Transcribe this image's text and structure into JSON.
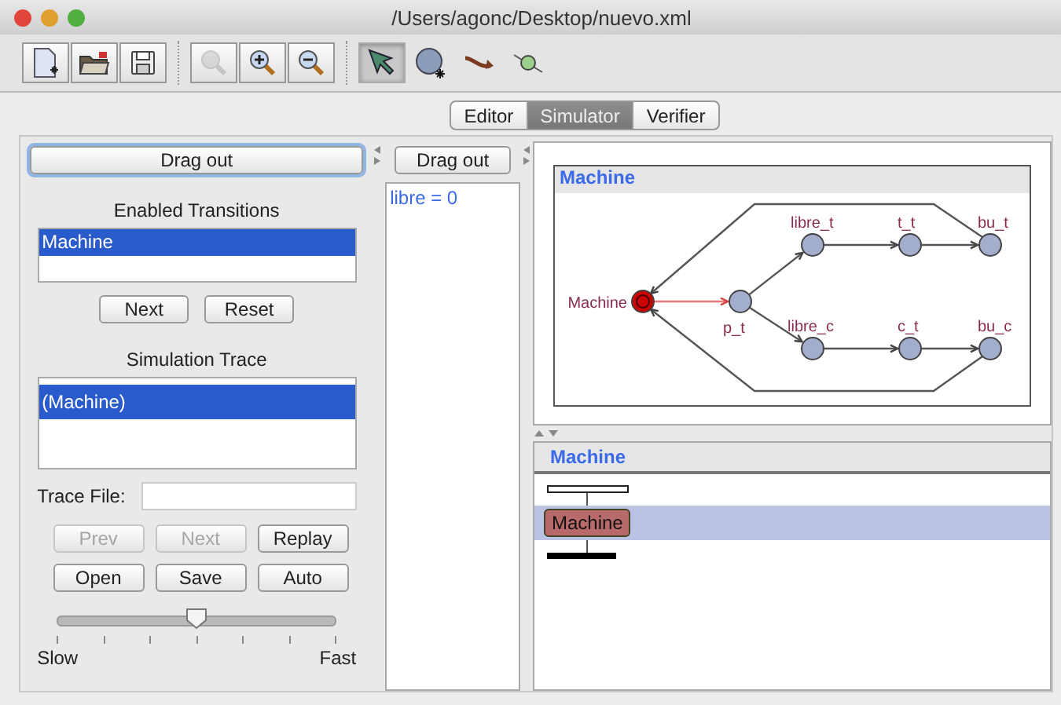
{
  "window": {
    "title": "/Users/agonc/Desktop/nuevo.xml"
  },
  "toolbar": [
    {
      "selected": false,
      "disabled": false
    },
    {
      "selected": false,
      "disabled": false
    },
    {
      "selected": false,
      "disabled": false
    },
    {
      "selected": false,
      "disabled": true
    },
    {
      "selected": false,
      "disabled": false
    },
    {
      "selected": false,
      "disabled": false
    },
    {
      "selected": true,
      "disabled": false
    },
    {
      "selected": false,
      "disabled": false
    },
    {
      "selected": false,
      "disabled": false
    },
    {
      "selected": false,
      "disabled": false
    }
  ],
  "tabs": [
    {
      "label": "Editor",
      "selected": false
    },
    {
      "label": "Simulator",
      "selected": true
    },
    {
      "label": "Verifier",
      "selected": false
    }
  ],
  "simulator": {
    "drag_out": "Drag out",
    "enabled_transitions": {
      "title": "Enabled Transitions",
      "items": [
        {
          "label": "Machine",
          "selected": true
        }
      ]
    },
    "transition_buttons": [
      {
        "label": "Next",
        "disabled": false
      },
      {
        "label": "Reset",
        "disabled": false
      }
    ],
    "trace": {
      "title": "Simulation Trace",
      "items": [
        {
          "label": "(Machine)",
          "selected": true
        }
      ]
    },
    "trace_file": {
      "label": "Trace File:"
    },
    "trace_buttons": [
      {
        "label": "Prev",
        "disabled": true
      },
      {
        "label": "Next",
        "disabled": true
      },
      {
        "label": "Replay",
        "disabled": false
      },
      {
        "label": "Open",
        "disabled": false
      },
      {
        "label": "Save",
        "disabled": false
      },
      {
        "label": "Auto",
        "disabled": false
      }
    ],
    "speed": {
      "level": 0.5,
      "min_label": "Slow",
      "max_label": "Fast"
    }
  },
  "variables": {
    "drag_out": "Drag out",
    "items": [
      "libre = 0"
    ]
  },
  "automaton": {
    "title": "Machine",
    "nodes": [
      {
        "label": "Machine",
        "current": true
      },
      {
        "label": "p_t",
        "current": false
      },
      {
        "label": "libre_t",
        "current": false
      },
      {
        "label": "t_t",
        "current": false
      },
      {
        "label": "bu_t",
        "current": false
      },
      {
        "label": "libre_c",
        "current": false
      },
      {
        "label": "c_t",
        "current": false
      },
      {
        "label": "bu_c",
        "current": false
      }
    ],
    "edges": [
      {
        "enabled": true
      },
      {
        "enabled": false
      },
      {
        "enabled": false
      },
      {
        "enabled": false
      },
      {
        "enabled": false
      },
      {
        "enabled": false
      },
      {
        "enabled": false
      },
      {
        "enabled": false
      },
      {
        "enabled": false
      }
    ]
  },
  "trace_view": {
    "title": "Machine",
    "rows": [
      {
        "label": "Machine",
        "selected": true
      }
    ]
  }
}
